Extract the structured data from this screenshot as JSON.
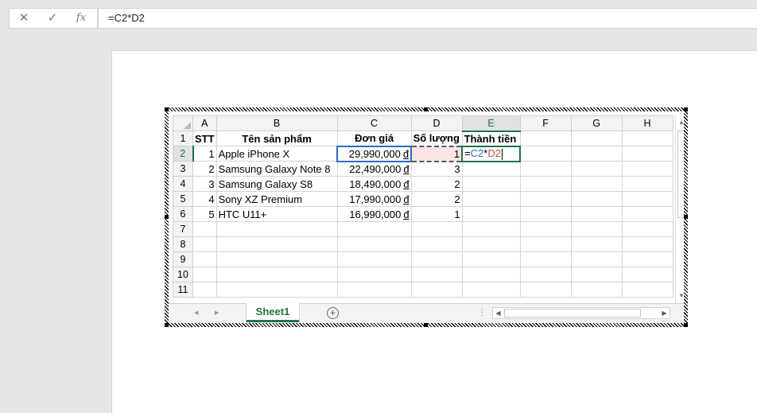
{
  "formula_bar": {
    "cancel_icon": "✕",
    "enter_icon": "✓",
    "function_icon": "fx",
    "formula": "=C2*D2"
  },
  "spreadsheet": {
    "columns": [
      "A",
      "B",
      "C",
      "D",
      "E",
      "F",
      "G",
      "H"
    ],
    "rows": [
      {
        "num": "1",
        "cells": [
          "STT",
          "Tên sản phẩm",
          "Đơn giá",
          "Số lượng",
          "Thành tiền",
          "",
          "",
          ""
        ]
      },
      {
        "num": "2",
        "cells": [
          "1",
          "Apple iPhone X",
          "29,990,000",
          "1",
          "",
          "",
          "",
          ""
        ]
      },
      {
        "num": "3",
        "cells": [
          "2",
          "Samsung Galaxy Note 8",
          "22,490,000",
          "3",
          "",
          "",
          "",
          ""
        ]
      },
      {
        "num": "4",
        "cells": [
          "3",
          "Samsung Galaxy S8",
          "18,490,000",
          "2",
          "",
          "",
          "",
          ""
        ]
      },
      {
        "num": "5",
        "cells": [
          "4",
          "Sony XZ Premium",
          "17,990,000",
          "2",
          "",
          "",
          "",
          ""
        ]
      },
      {
        "num": "6",
        "cells": [
          "5",
          "HTC U11+",
          "16,990,000",
          "1",
          "",
          "",
          "",
          ""
        ]
      },
      {
        "num": "7",
        "cells": [
          "",
          "",
          "",
          "",
          "",
          "",
          "",
          ""
        ]
      },
      {
        "num": "8",
        "cells": [
          "",
          "",
          "",
          "",
          "",
          "",
          "",
          ""
        ]
      },
      {
        "num": "9",
        "cells": [
          "",
          "",
          "",
          "",
          "",
          "",
          "",
          ""
        ]
      },
      {
        "num": "10",
        "cells": [
          "",
          "",
          "",
          "",
          "",
          "",
          "",
          ""
        ]
      },
      {
        "num": "11",
        "cells": [
          "",
          "",
          "",
          "",
          "",
          "",
          "",
          ""
        ]
      }
    ],
    "currency_symbol": "đ",
    "editing_cell": {
      "address": "E2",
      "prefix": "=",
      "ref1": "C2",
      "op": "*",
      "ref2": "D2"
    },
    "sheet_tab": "Sheet1",
    "colors": {
      "accent": "#217346",
      "ref_blue": "#2f69c6",
      "ref_red": "#c0504d"
    }
  }
}
